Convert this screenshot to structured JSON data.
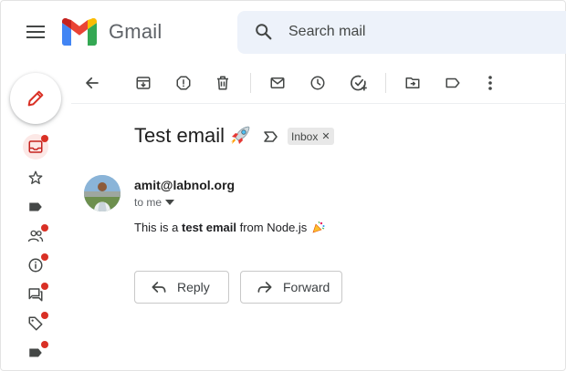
{
  "header": {
    "app_name": "Gmail",
    "search_placeholder": "Search mail"
  },
  "rail": {
    "items": [
      {
        "name": "inbox",
        "active": true,
        "badge": true
      },
      {
        "name": "starred",
        "active": false,
        "badge": false
      },
      {
        "name": "important",
        "active": false,
        "badge": false
      },
      {
        "name": "social",
        "active": false,
        "badge": true
      },
      {
        "name": "updates",
        "active": false,
        "badge": true
      },
      {
        "name": "forums",
        "active": false,
        "badge": true
      },
      {
        "name": "promotions",
        "active": false,
        "badge": true
      },
      {
        "name": "label",
        "active": false,
        "badge": true
      }
    ]
  },
  "toolbar": {
    "icons": [
      "back-icon",
      "archive-icon",
      "report-spam-icon",
      "delete-icon",
      "mark-unread-icon",
      "snooze-icon",
      "add-to-tasks-icon",
      "move-to-icon",
      "label-icon",
      "more-icon"
    ]
  },
  "message": {
    "subject": "Test email",
    "label_chip": "Inbox",
    "sender": "amit@labnol.org",
    "recipient": "to me",
    "body_prefix": "This is a ",
    "body_bold": "test email",
    "body_suffix": " from Node.js"
  },
  "actions": {
    "reply": "Reply",
    "forward": "Forward"
  },
  "colors": {
    "badge": "#d93025",
    "active_bg": "#fce8e6",
    "search_bg": "#edf2fa"
  }
}
